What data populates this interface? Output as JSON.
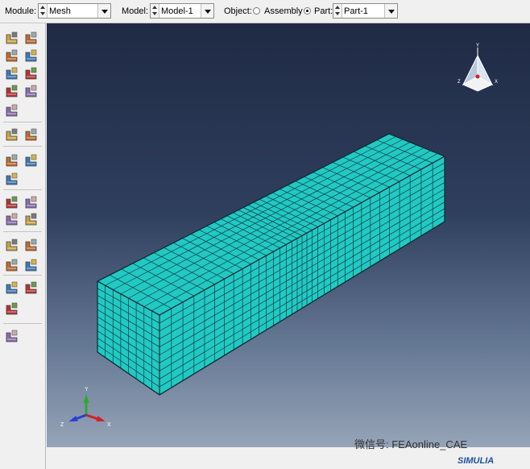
{
  "context_bar": {
    "module_label": "Module:",
    "module_value": "Mesh",
    "model_label": "Model:",
    "model_value": "Model-1",
    "object_label": "Object:",
    "assembly_label": "Assembly",
    "part_label": "Part:",
    "part_value": "Part-1",
    "selected_object": "Part"
  },
  "toolbox": {
    "rows": [
      [
        "seed-part-icon",
        "seed-edges-icon"
      ],
      [
        "seed-delete-part-icon",
        "seed-delete-edges-icon"
      ],
      [
        "assign-mesh-controls-icon",
        "assign-element-type-icon"
      ],
      [
        "mesh-part-icon",
        "verify-mesh-icon"
      ],
      [
        "partition-cell-icon"
      ],
      [
        "query-mesh-icon",
        "mesh-statistics-icon"
      ],
      [
        "edit-mesh-icon",
        "edit-mesh-tools-icon"
      ],
      [
        "part-tools-icon"
      ],
      [
        "create-datum-point-icon",
        "create-partition-icon"
      ],
      [
        "virtual-topology-icon",
        "repair-geometry-icon"
      ],
      [
        "datum-axis-icon",
        "datum-plane-icon"
      ],
      [
        "datum-csys-icon",
        "datum-point-offset-icon"
      ],
      [
        "set-manager-icon",
        "surface-manager-icon"
      ],
      [
        "display-group-icon"
      ],
      [
        "tools-wrench-icon"
      ]
    ]
  },
  "viewport": {
    "model_color": "#22c9c2",
    "mesh_line_color": "#0d3d46",
    "view_cube_labels": [
      "Y",
      "Z",
      "X"
    ],
    "triad_labels": {
      "x": "X",
      "y": "Y",
      "z": "Z"
    },
    "triad_colors": {
      "x": "#d22020",
      "y": "#2fa830",
      "z": "#2a3fd0"
    }
  },
  "footer": {
    "watermark": "微信号: FEAonline_CAE",
    "brand": "SIMULIA"
  }
}
